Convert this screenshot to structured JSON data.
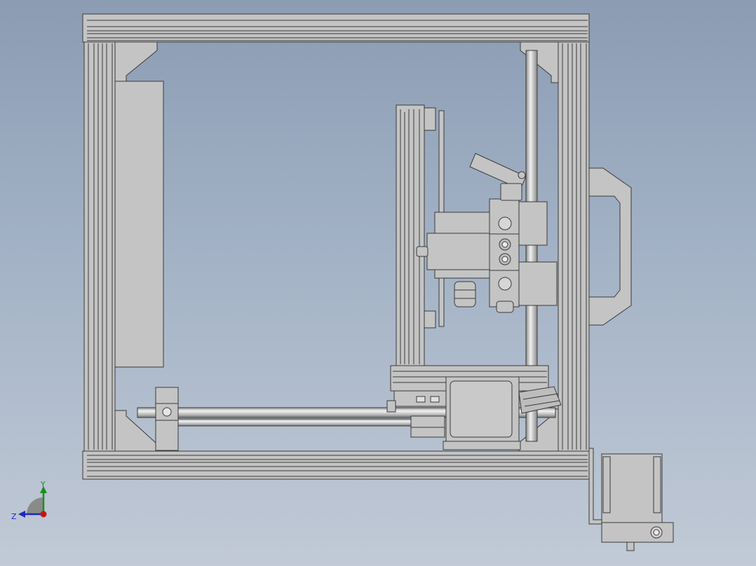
{
  "view": {
    "background_top": "#8b9cb3",
    "background_bottom": "#c1cad6",
    "part_color": "#c4c4c4",
    "edge_color": "#3a3a3a"
  },
  "triad": {
    "y_label": "Y",
    "z_label": "Z",
    "y_axis_color": "#1a8f1a",
    "z_axis_color": "#1a2bbf",
    "x_axis_color": "#c81414"
  }
}
